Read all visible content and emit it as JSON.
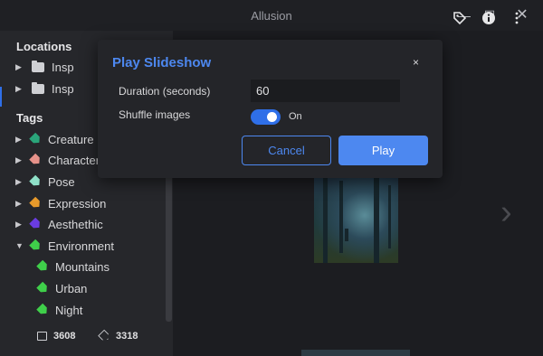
{
  "app": {
    "title": "Allusion"
  },
  "window_controls": {
    "minimize": "—",
    "maximize": "☐",
    "close": "✕"
  },
  "sidebar": {
    "locations_title": "Locations",
    "locations": [
      {
        "label": "Insp"
      },
      {
        "label": "Insp"
      }
    ],
    "tags_title": "Tags",
    "tags": [
      {
        "label": "Creature",
        "color": "#2aa57a",
        "expanded": false
      },
      {
        "label": "Character",
        "color": "#e6928a",
        "expanded": false
      },
      {
        "label": "Pose",
        "color": "#8fe0c8",
        "expanded": false
      },
      {
        "label": "Expression",
        "color": "#e79a2b",
        "expanded": false
      },
      {
        "label": "Aesthethic",
        "color": "#6a3ce0",
        "expanded": false
      },
      {
        "label": "Environment",
        "color": "#3fcf4a",
        "expanded": true
      }
    ],
    "subtags": [
      {
        "label": "Mountains",
        "color": "#3fcf4a"
      },
      {
        "label": "Urban",
        "color": "#3fcf4a"
      },
      {
        "label": "Night",
        "color": "#3fcf4a"
      }
    ],
    "footer": {
      "image_count": "3608",
      "tag_count": "3318"
    }
  },
  "toolbar": {
    "icons": [
      "tag-icon",
      "info-icon",
      "more-vertical-icon"
    ]
  },
  "dialog": {
    "title": "Play Slideshow",
    "close_glyph": "×",
    "duration_label": "Duration (seconds)",
    "duration_value": "60",
    "shuffle_label": "Shuffle images",
    "shuffle_state": "On",
    "shuffle_on": true,
    "cancel_label": "Cancel",
    "play_label": "Play"
  },
  "colors": {
    "accent": "#4d88f0",
    "toggle": "#2f6fe8"
  }
}
